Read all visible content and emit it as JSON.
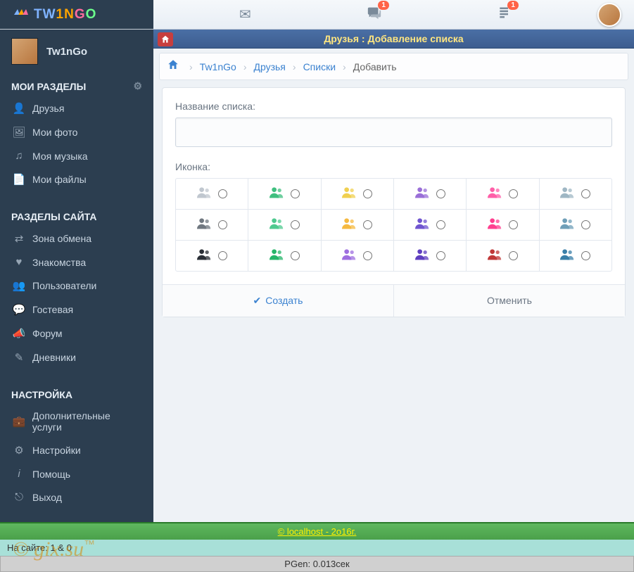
{
  "logo": "TW1NGO",
  "topbar": {
    "chat_badge": "1",
    "notif_badge": "1"
  },
  "sidebar": {
    "username": "Tw1nGo",
    "sections": {
      "my": {
        "title": "МОИ РАЗДЕЛЫ",
        "items": [
          {
            "icon": "friends",
            "label": "Друзья"
          },
          {
            "icon": "photo",
            "label": "Мои фото"
          },
          {
            "icon": "music",
            "label": "Моя музыка"
          },
          {
            "icon": "files",
            "label": "Мои файлы"
          }
        ]
      },
      "site": {
        "title": "РАЗДЕЛЫ САЙТА",
        "items": [
          {
            "icon": "exchange",
            "label": "Зона обмена"
          },
          {
            "icon": "heart",
            "label": "Знакомства"
          },
          {
            "icon": "users",
            "label": "Пользователи"
          },
          {
            "icon": "guest",
            "label": "Гостевая"
          },
          {
            "icon": "forum",
            "label": "Форум"
          },
          {
            "icon": "diary",
            "label": "Дневники"
          }
        ]
      },
      "settings": {
        "title": "НАСТРОЙКА",
        "items": [
          {
            "icon": "services",
            "label": "Дополнительные услуги"
          },
          {
            "icon": "settings",
            "label": "Настройки"
          },
          {
            "icon": "help",
            "label": "Помощь"
          },
          {
            "icon": "logout",
            "label": "Выход"
          }
        ]
      }
    }
  },
  "page": {
    "title": "Друзья : Добавление списка",
    "breadcrumb": {
      "items": [
        "Tw1nGo",
        "Друзья",
        "Списки"
      ],
      "current": "Добавить"
    },
    "form": {
      "name_label": "Название списка:",
      "name_value": "",
      "icon_label": "Иконка:",
      "icon_colors": [
        [
          "#c0c7cf",
          "#3fbf7f",
          "#f0d050",
          "#9a6fd8",
          "#ff5fa8",
          "#9fb7c4"
        ],
        [
          "#707880",
          "#4fc98f",
          "#f5b940",
          "#7055d0",
          "#ff3f8f",
          "#6f9fb8"
        ],
        [
          "#2a2f36",
          "#26b56a",
          "#9f6fe0",
          "#5f3fc0",
          "#c03838",
          "#3a7fa8"
        ]
      ],
      "create_label": "Создать",
      "cancel_label": "Отменить"
    }
  },
  "footer": {
    "copyright": "© localhost - 2o16г.",
    "online": "На сайте: 1 & 0",
    "pgen": "PGen: 0.013сек",
    "watermark": "© gix.su™"
  }
}
